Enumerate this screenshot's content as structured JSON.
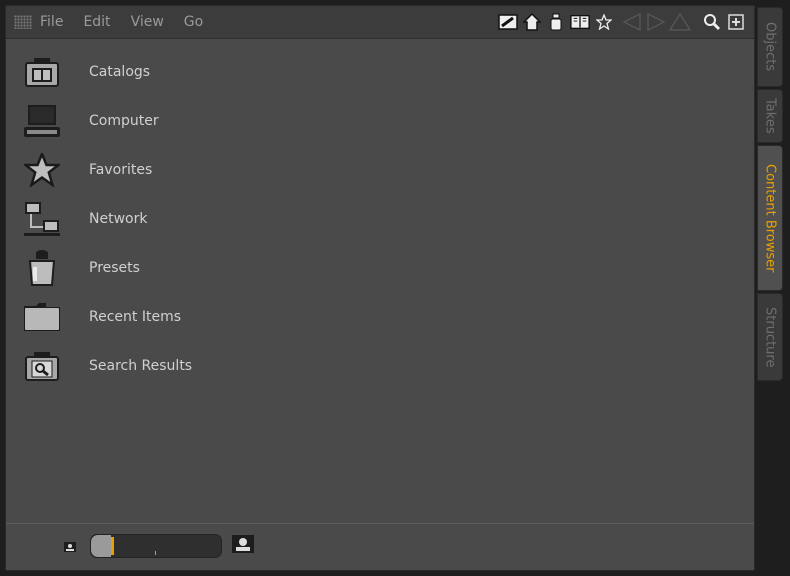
{
  "menubar": {
    "menus": [
      "File",
      "Edit",
      "View",
      "Go"
    ]
  },
  "toolbar": {
    "icons": [
      "edit-icon",
      "home-icon",
      "presets-icon",
      "catalog-book-icon",
      "favorite-star-icon",
      "back-nav-icon",
      "forward-nav-icon",
      "up-nav-icon",
      "search-icon",
      "new-window-icon"
    ]
  },
  "locations": [
    {
      "label": "Catalogs",
      "icon": "catalog-icon"
    },
    {
      "label": "Computer",
      "icon": "computer-icon"
    },
    {
      "label": "Favorites",
      "icon": "star-icon"
    },
    {
      "label": "Network",
      "icon": "network-icon"
    },
    {
      "label": "Presets",
      "icon": "presets-jar-icon"
    },
    {
      "label": "Recent Items",
      "icon": "folder-icon"
    },
    {
      "label": "Search Results",
      "icon": "search-folder-icon"
    }
  ],
  "zoom": {
    "value": 0.15
  },
  "side_tabs": [
    {
      "label": "Objects",
      "active": false
    },
    {
      "label": "Takes",
      "active": false
    },
    {
      "label": "Content Browser",
      "active": true
    },
    {
      "label": "Structure",
      "active": false
    }
  ],
  "colors": {
    "accent": "#e8a000",
    "panel": "#4a4a4a",
    "text": "#d0d0d0"
  }
}
